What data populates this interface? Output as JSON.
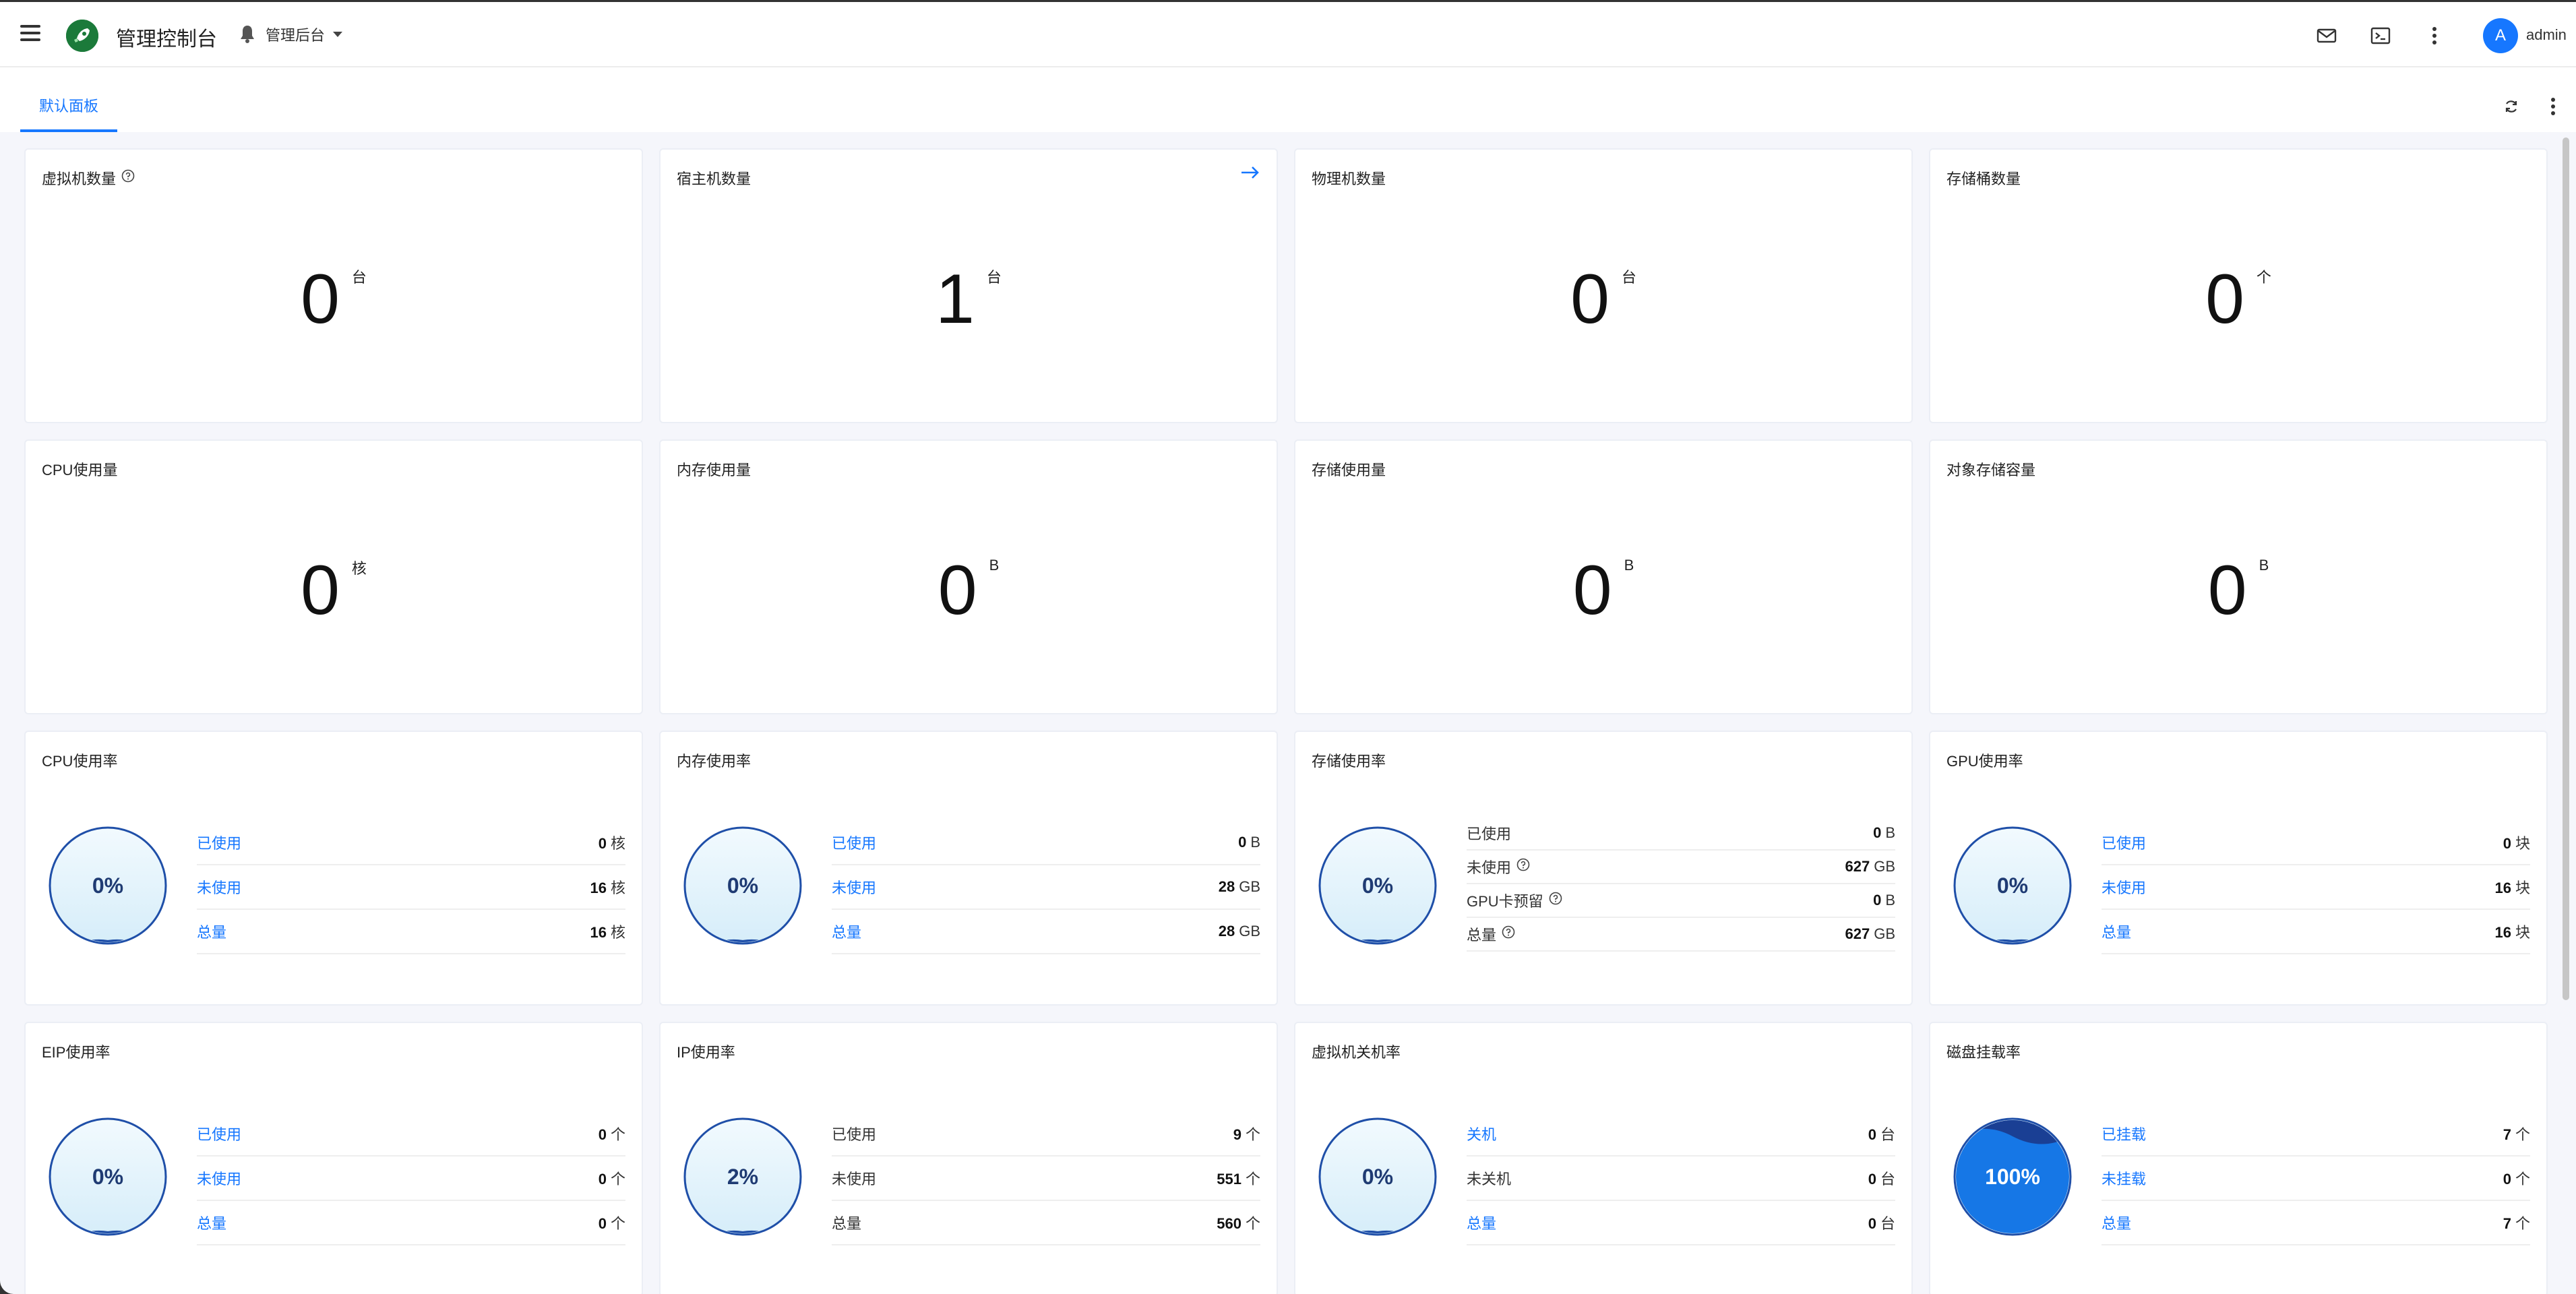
{
  "header": {
    "app_title": "管理控制台",
    "scope_label": "管理后台",
    "avatar_letter": "A",
    "username": "admin"
  },
  "tabs": [
    {
      "label": "默认面板",
      "active": true
    }
  ],
  "colors": {
    "accent": "#1677ff",
    "gauge_stroke": "#1f4fa8",
    "gauge_fill": "#e3f3fc",
    "gauge_full": "#1677e6",
    "background": "#f5f6fb"
  },
  "stat_cards": [
    {
      "title": "虚拟机数量",
      "value": "0",
      "unit": "台",
      "help": true
    },
    {
      "title": "宿主机数量",
      "value": "1",
      "unit": "台",
      "arrow": true
    },
    {
      "title": "物理机数量",
      "value": "0",
      "unit": "台"
    },
    {
      "title": "存储桶数量",
      "value": "0",
      "unit": "个"
    },
    {
      "title": "CPU使用量",
      "value": "0",
      "unit": "核"
    },
    {
      "title": "内存使用量",
      "value": "0",
      "unit": "B"
    },
    {
      "title": "存储使用量",
      "value": "0",
      "unit": "B"
    },
    {
      "title": "对象存储容量",
      "value": "0",
      "unit": "B"
    }
  ],
  "gauge_cards": [
    {
      "title": "CPU使用率",
      "percent_label": "0%",
      "percent": 0,
      "rows": [
        {
          "label": "已使用",
          "value": "0",
          "unit": "核",
          "link": true
        },
        {
          "label": "未使用",
          "value": "16",
          "unit": "核",
          "link": true
        },
        {
          "label": "总量",
          "value": "16",
          "unit": "核",
          "link": true
        }
      ]
    },
    {
      "title": "内存使用率",
      "percent_label": "0%",
      "percent": 0,
      "rows": [
        {
          "label": "已使用",
          "value": "0",
          "unit": "B",
          "link": true
        },
        {
          "label": "未使用",
          "value": "28",
          "unit": "GB",
          "link": true
        },
        {
          "label": "总量",
          "value": "28",
          "unit": "GB",
          "link": true
        }
      ]
    },
    {
      "title": "存储使用率",
      "percent_label": "0%",
      "percent": 0,
      "rows": [
        {
          "label": "已使用",
          "value": "0",
          "unit": "B",
          "link": false
        },
        {
          "label": "未使用",
          "value": "627",
          "unit": "GB",
          "link": false,
          "help": true
        },
        {
          "label": "GPU卡预留",
          "value": "0",
          "unit": "B",
          "link": false,
          "help": true
        },
        {
          "label": "总量",
          "value": "627",
          "unit": "GB",
          "link": false,
          "help": true
        }
      ]
    },
    {
      "title": "GPU使用率",
      "percent_label": "0%",
      "percent": 0,
      "rows": [
        {
          "label": "已使用",
          "value": "0",
          "unit": "块",
          "link": true
        },
        {
          "label": "未使用",
          "value": "16",
          "unit": "块",
          "link": true
        },
        {
          "label": "总量",
          "value": "16",
          "unit": "块",
          "link": true
        }
      ]
    },
    {
      "title": "EIP使用率",
      "percent_label": "0%",
      "percent": 0,
      "rows": [
        {
          "label": "已使用",
          "value": "0",
          "unit": "个",
          "link": true
        },
        {
          "label": "未使用",
          "value": "0",
          "unit": "个",
          "link": true
        },
        {
          "label": "总量",
          "value": "0",
          "unit": "个",
          "link": true
        }
      ]
    },
    {
      "title": "IP使用率",
      "percent_label": "2%",
      "percent": 2,
      "rows": [
        {
          "label": "已使用",
          "value": "9",
          "unit": "个",
          "link": false
        },
        {
          "label": "未使用",
          "value": "551",
          "unit": "个",
          "link": false
        },
        {
          "label": "总量",
          "value": "560",
          "unit": "个",
          "link": false
        }
      ]
    },
    {
      "title": "虚拟机关机率",
      "percent_label": "0%",
      "percent": 0,
      "rows": [
        {
          "label": "关机",
          "value": "0",
          "unit": "台",
          "link": true
        },
        {
          "label": "未关机",
          "value": "0",
          "unit": "台",
          "link": false
        },
        {
          "label": "总量",
          "value": "0",
          "unit": "台",
          "link": true
        }
      ]
    },
    {
      "title": "磁盘挂载率",
      "percent_label": "100%",
      "percent": 100,
      "rows": [
        {
          "label": "已挂载",
          "value": "7",
          "unit": "个",
          "link": true
        },
        {
          "label": "未挂载",
          "value": "0",
          "unit": "个",
          "link": true
        },
        {
          "label": "总量",
          "value": "7",
          "unit": "个",
          "link": true
        }
      ]
    }
  ]
}
